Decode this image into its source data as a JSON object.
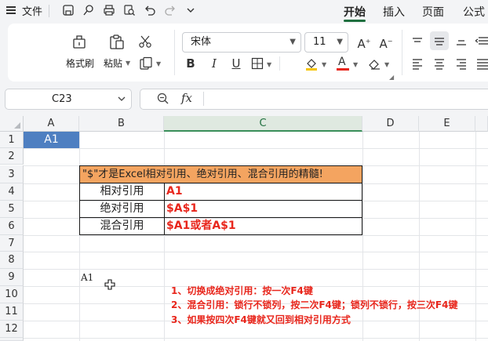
{
  "menu": {
    "file_label": "文件",
    "tabs": [
      {
        "label": "开始",
        "active": true
      },
      {
        "label": "插入",
        "active": false
      },
      {
        "label": "页面",
        "active": false
      },
      {
        "label": "公式",
        "active": false
      }
    ]
  },
  "ribbon": {
    "format_painter_label": "格式刷",
    "paste_label": "粘贴",
    "font_name": "宋体",
    "font_size": "11"
  },
  "formula_bar": {
    "name_box": "C23",
    "fx_label": "fx",
    "formula": ""
  },
  "sheet": {
    "columns": [
      "A",
      "B",
      "C",
      "D",
      "E"
    ],
    "rows": [
      "1",
      "2",
      "3",
      "4",
      "5",
      "6",
      "7",
      "8",
      "9",
      "10",
      "11",
      "12"
    ],
    "a1_value": "A1",
    "table": {
      "header": "\"$\"才是Excel相对引用、绝对引用、混合引用的精髓!",
      "rows": [
        {
          "label": "相对引用",
          "value": "A1"
        },
        {
          "label": "绝对引用",
          "value": "$A$1"
        },
        {
          "label": "混合引用",
          "value": "$A1或者A$1"
        }
      ]
    },
    "b9_text": "A1",
    "notes": [
      "1、切换成绝对引用：按一次F4键",
      "2、混合引用：锁行不锁列，按二次F4键；锁列不锁行，按三次F4键",
      "3、如果按四次F4键就又回到相对引用方式"
    ]
  },
  "colors": {
    "accent_green": "#1f6f3f",
    "header_orange": "#f4a460",
    "selected_cell_blue": "#4e7fc1",
    "note_red": "#e8261c"
  }
}
